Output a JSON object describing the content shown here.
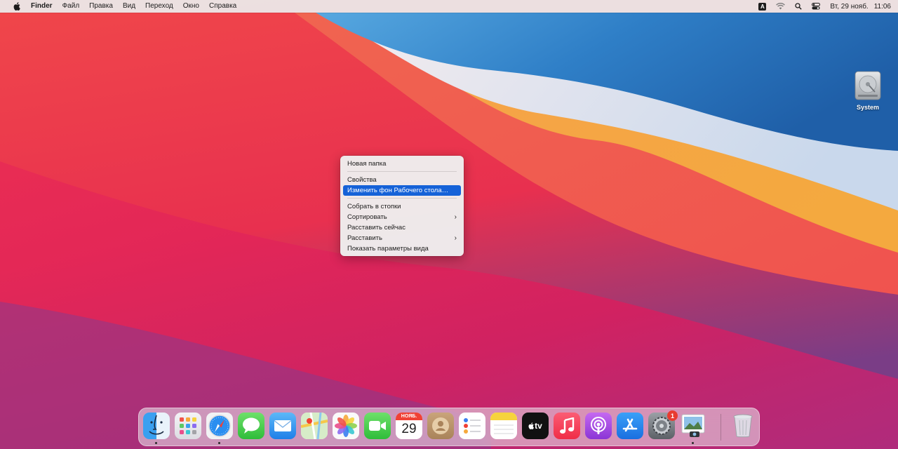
{
  "menubar": {
    "app_name": "Finder",
    "menus": [
      "Файл",
      "Правка",
      "Вид",
      "Переход",
      "Окно",
      "Справка"
    ],
    "input_source": "A",
    "date": "Вт, 29 нояб.",
    "time": "11:06"
  },
  "desktop": {
    "icons": [
      {
        "label": "System",
        "icon": "hard-drive-icon"
      }
    ]
  },
  "context_menu": {
    "items": [
      {
        "label": "Новая папка",
        "separator_after": true
      },
      {
        "label": "Свойства"
      },
      {
        "label": "Изменить фон Рабочего стола…",
        "highlighted": true,
        "separator_after": true
      },
      {
        "label": "Собрать в стопки"
      },
      {
        "label": "Сортировать",
        "submenu": true
      },
      {
        "label": "Расставить сейчас"
      },
      {
        "label": "Расставить",
        "submenu": true
      },
      {
        "label": "Показать параметры вида"
      }
    ],
    "highlight_color": "#1562d8"
  },
  "dock": {
    "apps": [
      {
        "name": "finder",
        "running": true
      },
      {
        "name": "launchpad"
      },
      {
        "name": "safari",
        "running": true
      },
      {
        "name": "messages"
      },
      {
        "name": "mail"
      },
      {
        "name": "maps"
      },
      {
        "name": "photos"
      },
      {
        "name": "facetime"
      },
      {
        "name": "calendar",
        "month": "НОЯБ.",
        "day": "29"
      },
      {
        "name": "contacts"
      },
      {
        "name": "reminders"
      },
      {
        "name": "notes"
      },
      {
        "name": "tv",
        "label": "tv"
      },
      {
        "name": "music"
      },
      {
        "name": "podcasts"
      },
      {
        "name": "app-store"
      },
      {
        "name": "system-preferences",
        "badge": "1"
      },
      {
        "name": "preview",
        "running": true
      },
      {
        "name": "trash"
      }
    ]
  }
}
